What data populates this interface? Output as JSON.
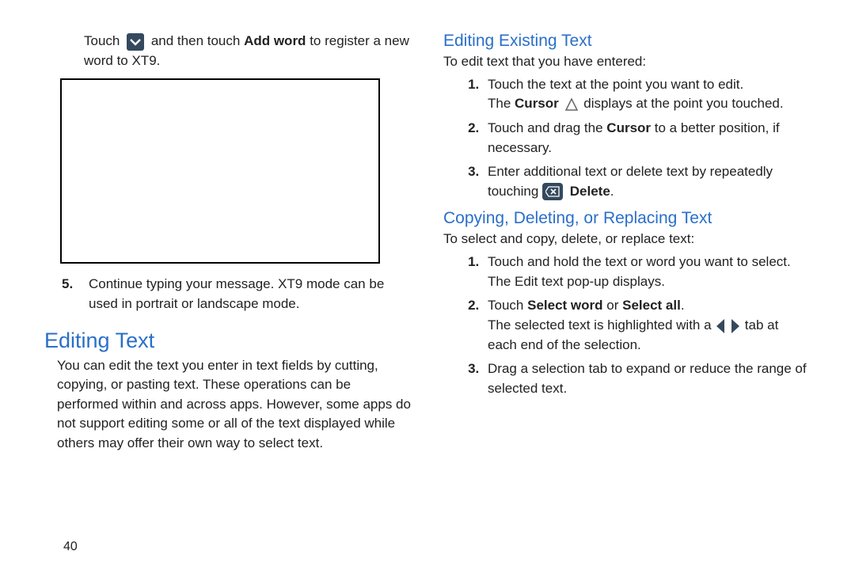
{
  "left": {
    "intro_a": "Touch",
    "intro_b": "and then touch",
    "intro_bold": "Add word",
    "intro_c": "to register a new word to XT9.",
    "item5": "Continue typing your message. XT9 mode can be used in portrait or landscape mode.",
    "heading": "Editing Text",
    "body": "You can edit the text you enter in text fields by cutting, copying, or pasting text. These operations can be performed within and across apps. However, some apps do not support editing some or all of the text displayed while others may offer their own way to select text."
  },
  "right": {
    "sub1": "Editing Existing Text",
    "sub1_intro": "To edit text that you have entered:",
    "s1_i1": "Touch the text at the point you want to edit.",
    "s1_i1b_a": "The",
    "s1_i1b_bold": "Cursor",
    "s1_i1b_c": "displays at the point you touched.",
    "s1_i2_a": "Touch and drag the",
    "s1_i2_bold": "Cursor",
    "s1_i2_b": "to a better position, if necessary.",
    "s1_i3_a": "Enter additional text or delete text by repeatedly touching",
    "s1_i3_bold": "Delete",
    "s1_i3_b": ".",
    "sub2": "Copying, Deleting, or Replacing Text",
    "sub2_intro": "To select and copy, delete, or replace text:",
    "s2_i1": "Touch and hold the text or word you want to select. The Edit text pop-up displays.",
    "s2_i2_a": "Touch",
    "s2_i2_bold1": "Select word",
    "s2_i2_mid": "or",
    "s2_i2_bold2": "Select all",
    "s2_i2_b": ".",
    "s2_i2_line2_a": "The selected text is highlighted with a",
    "s2_i2_line2_b": "tab at each end of the selection.",
    "s2_i3": "Drag a selection tab to expand or reduce the range of selected text."
  },
  "page_number": "40"
}
